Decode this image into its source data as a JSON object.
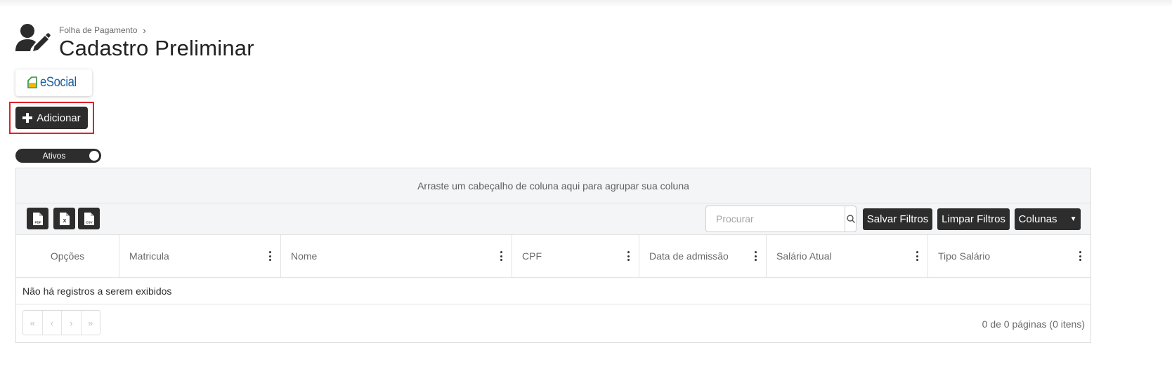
{
  "breadcrumb": {
    "parent": "Folha de Pagamento",
    "separator_icon": "chevron-right-icon"
  },
  "page": {
    "title": "Cadastro Preliminar",
    "icon": "user-edit-icon"
  },
  "esocial": {
    "label": "eSocial",
    "logo_icon": "esocial-logo-icon",
    "brand_color": "#1a5f9e"
  },
  "actions": {
    "add_label": "Adicionar",
    "add_icon": "plus-icon",
    "highlight_color": "#e21f26"
  },
  "toggle": {
    "label": "Ativos",
    "state": "on"
  },
  "grid": {
    "group_panel_text": "Arraste um cabeçalho de coluna aqui para agrupar sua coluna",
    "exports": [
      {
        "label": "PDF",
        "icon": "pdf-file-icon"
      },
      {
        "label": "X",
        "icon": "excel-file-icon"
      },
      {
        "label": "CSV",
        "icon": "csv-file-icon"
      }
    ],
    "search": {
      "placeholder": "Procurar",
      "value": "",
      "icon": "search-icon"
    },
    "buttons": {
      "save_filters": "Salvar Filtros",
      "clear_filters": "Limpar Filtros",
      "columns": "Colunas"
    },
    "columns": [
      {
        "label": "Opções",
        "menu": false
      },
      {
        "label": "Matricula",
        "menu": true
      },
      {
        "label": "Nome",
        "menu": true
      },
      {
        "label": "CPF",
        "menu": true
      },
      {
        "label": "Data de admissão",
        "menu": true
      },
      {
        "label": "Salário Atual",
        "menu": true
      },
      {
        "label": "Tipo Salário",
        "menu": true
      }
    ],
    "empty_text": "Não há registros a serem exibidos",
    "pager": {
      "first": "«",
      "prev": "‹",
      "next": "›",
      "last": "»",
      "info": "0 de 0 páginas (0 itens)"
    }
  },
  "colors": {
    "dark_button": "#2d2d2d",
    "panel_bg": "#f4f5f7"
  }
}
